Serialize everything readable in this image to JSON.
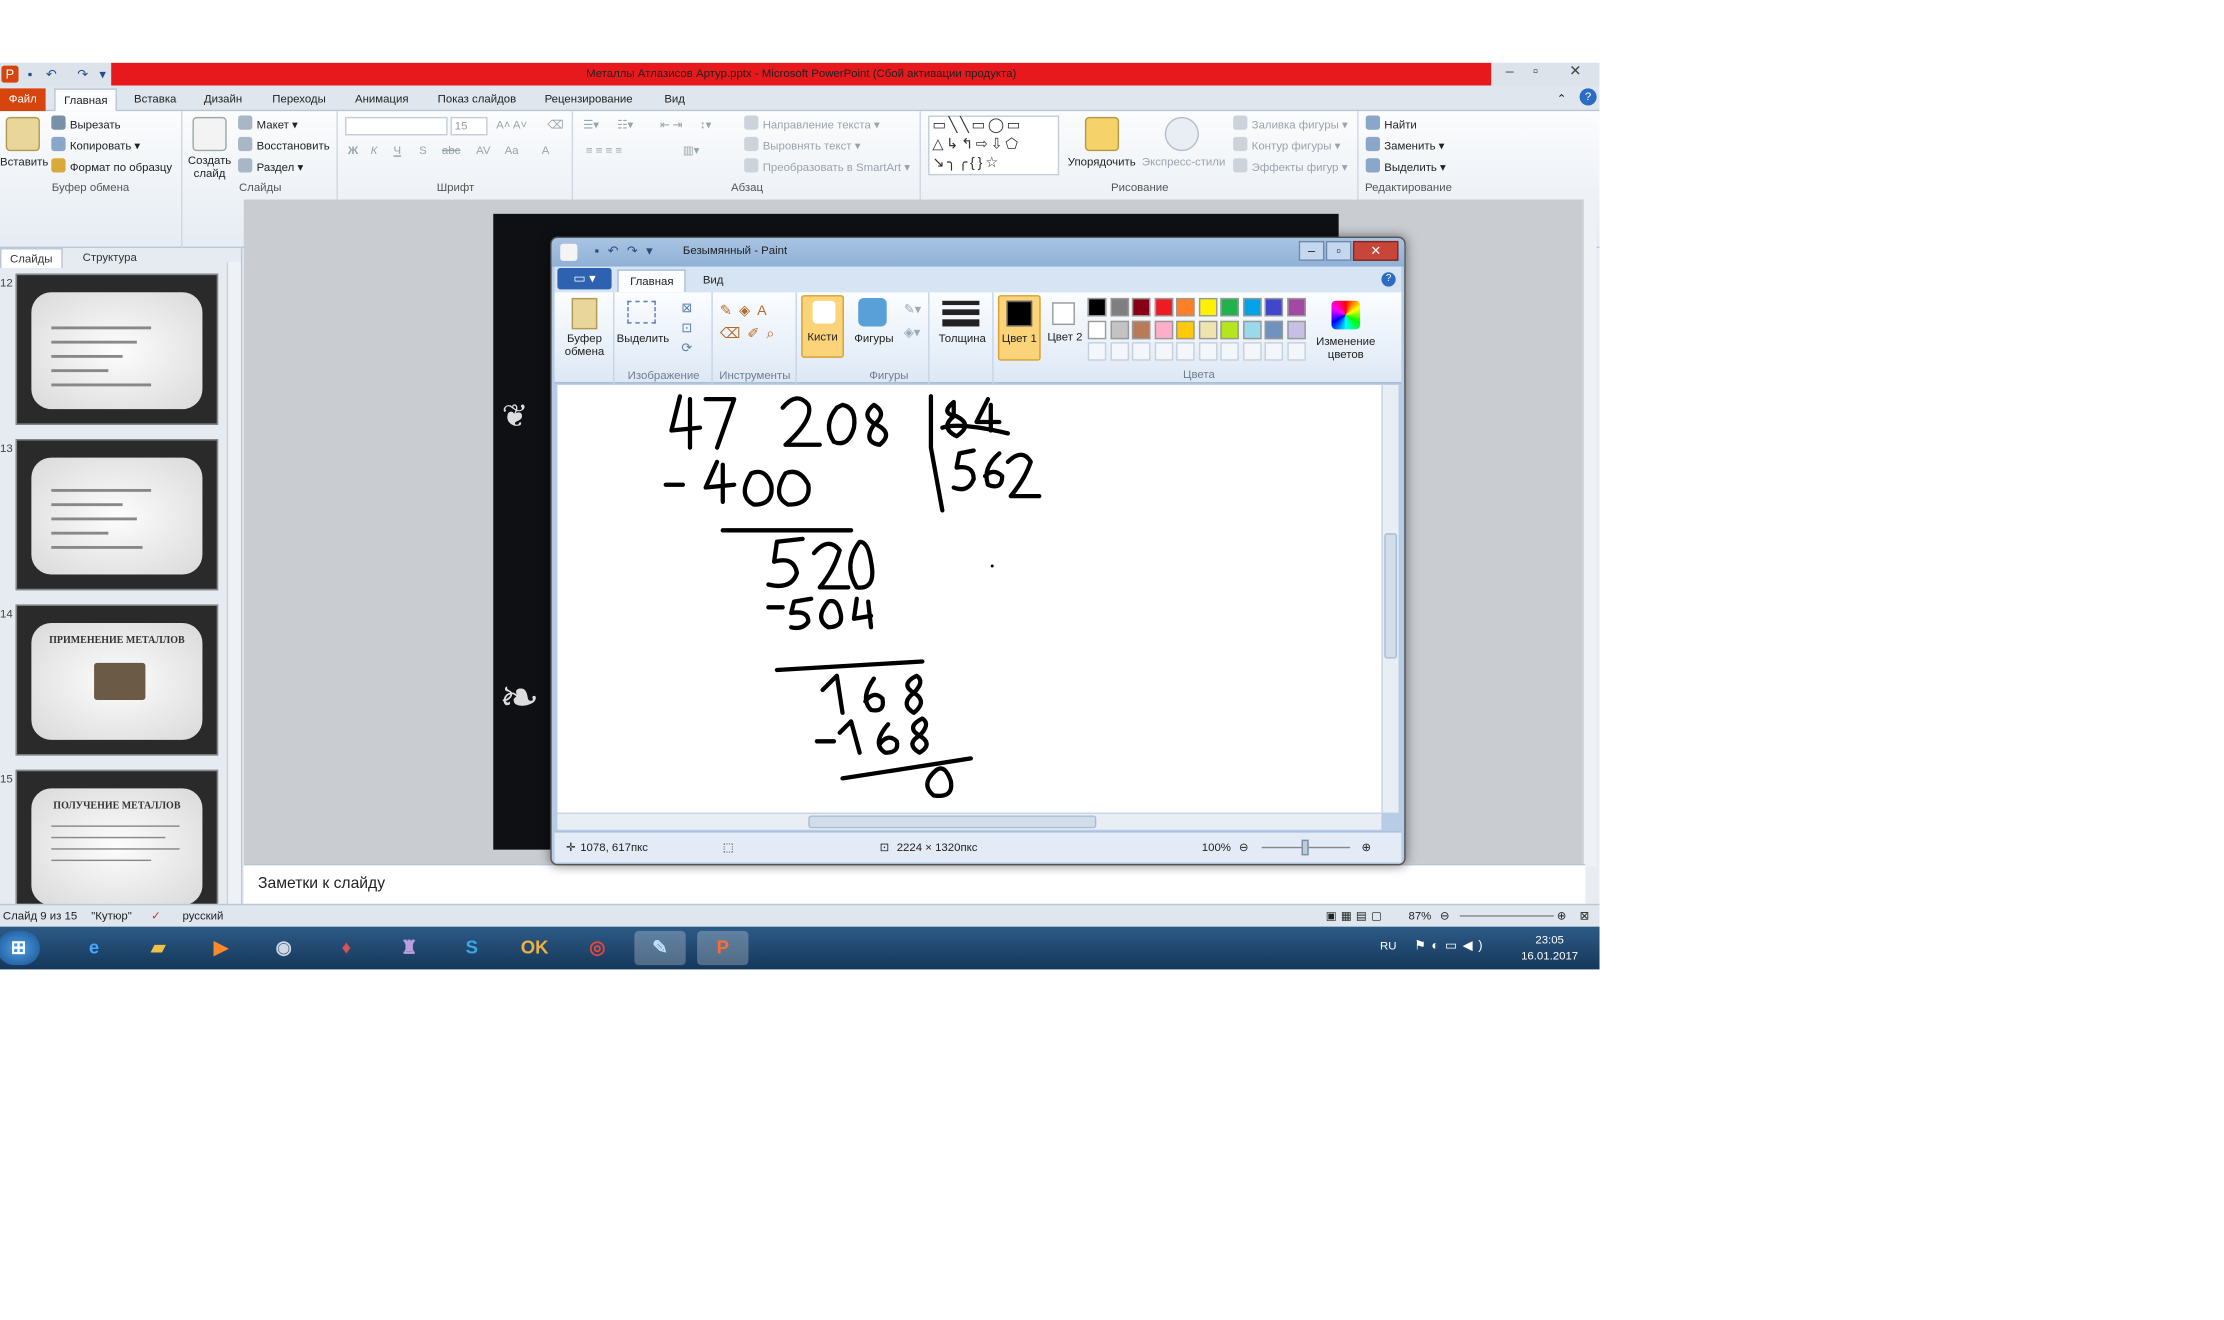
{
  "powerpoint": {
    "title": "Металлы Атлазисов Артур.pptx  -  Microsoft PowerPoint (Сбой активации продукта)",
    "tabs": [
      "Файл",
      "Главная",
      "Вставка",
      "Дизайн",
      "Переходы",
      "Анимация",
      "Показ слайдов",
      "Рецензирование",
      "Вид"
    ],
    "ribbon": {
      "clipboard": {
        "paste": "Вставить",
        "cut": "Вырезать",
        "copy": "Копировать",
        "format_painter": "Формат по образцу",
        "label": "Буфер обмена"
      },
      "slides": {
        "new_slide": "Создать слайд",
        "layout": "Макет",
        "reset": "Восстановить",
        "section": "Раздел",
        "label": "Слайды"
      },
      "font": {
        "size": "15",
        "label": "Шрифт"
      },
      "paragraph": {
        "text_direction": "Направление текста",
        "align_text": "Выровнять текст",
        "smartart": "Преобразовать в SmartArt",
        "label": "Абзац"
      },
      "drawing": {
        "arrange": "Упорядочить",
        "quick_styles": "Экспресс-стили",
        "shape_fill": "Заливка фигуры",
        "shape_outline": "Контур фигуры",
        "shape_effects": "Эффекты фигур",
        "label": "Рисование"
      },
      "editing": {
        "find": "Найти",
        "replace": "Заменить",
        "select": "Выделить",
        "label": "Редактирование"
      }
    },
    "left_tabs": [
      "Слайды",
      "Структура"
    ],
    "thumbnails": [
      {
        "num": "12",
        "title": ""
      },
      {
        "num": "13",
        "title": ""
      },
      {
        "num": "14",
        "title": "ПРИМЕНЕНИЕ МЕТАЛЛОВ"
      },
      {
        "num": "15",
        "title": "ПОЛУЧЕНИЕ МЕТАЛЛОВ"
      }
    ],
    "notes_placeholder": "Заметки к слайду",
    "status": {
      "slide": "Слайд 9 из 15",
      "theme": "\"Кутюр\"",
      "lang": "русский",
      "zoom": "87%"
    }
  },
  "paint": {
    "title": "Безымянный - Paint",
    "tabs": [
      "Главная",
      "Вид"
    ],
    "groups": {
      "clipboard": "Буфер обмена",
      "select": "Выделить",
      "image": "Изображение",
      "tools": "Инструменты",
      "brushes": "Кисти",
      "shapes_btn": "Фигуры",
      "shapes": "Фигуры",
      "size": "Толщина",
      "color1": "Цвет 1",
      "color2": "Цвет 2",
      "colors": "Цвета",
      "edit_colors": "Изменение цветов"
    },
    "palette": [
      "#000000",
      "#7f7f7f",
      "#880015",
      "#ed1c24",
      "#ff7f27",
      "#fff200",
      "#22b14c",
      "#00a2e8",
      "#3f48cc",
      "#a349a4",
      "#ffffff",
      "#c3c3c3",
      "#b97a57",
      "#ffaec9",
      "#ffc90e",
      "#efe4b0",
      "#b5e61d",
      "#99d9ea",
      "#7092be",
      "#c8bfe7"
    ],
    "status": {
      "cursor": "1078, 617пкс",
      "size": "2224 × 1320пкс",
      "zoom": "100%"
    }
  },
  "taskbar": {
    "lang": "RU",
    "time": "23:05",
    "date": "16.01.2017"
  }
}
